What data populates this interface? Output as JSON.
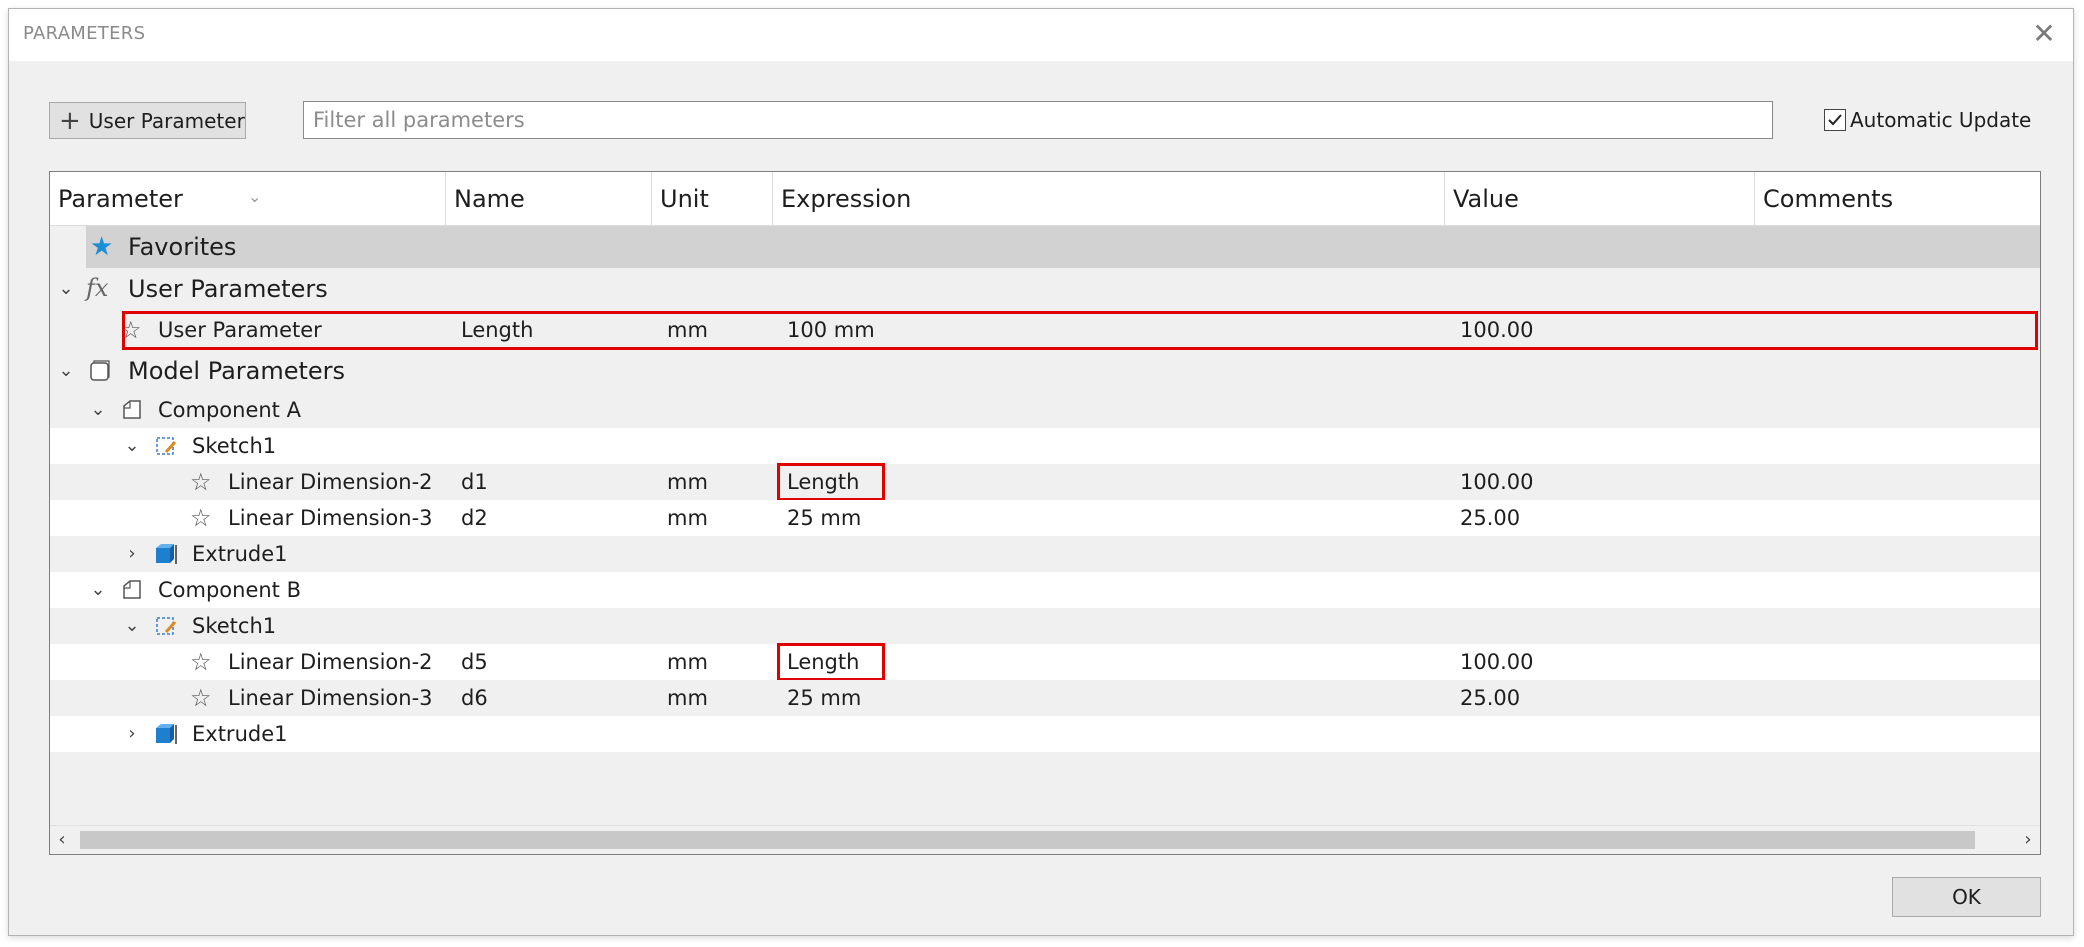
{
  "dialog": {
    "title": "PARAMETERS",
    "close_glyph": "✕",
    "add_button_label": "User Parameter",
    "add_button_glyph": "+",
    "filter_placeholder": "Filter all parameters",
    "auto_update_label": "Automatic Update",
    "auto_update_checked": true,
    "ok_label": "OK"
  },
  "columns": [
    "Parameter",
    "Name",
    "Unit",
    "Expression",
    "Value",
    "Comments"
  ],
  "groups": {
    "favorites": "Favorites",
    "user_parameters": "User Parameters",
    "model_parameters": "Model Parameters"
  },
  "user_parameter_row": {
    "parameter": "User Parameter",
    "name": "Length",
    "unit": "mm",
    "expression": "100 mm",
    "value": "100.00"
  },
  "component_a": {
    "label": "Component A",
    "sketch": "Sketch1",
    "rows": [
      {
        "parameter": "Linear Dimension-2",
        "name": "d1",
        "unit": "mm",
        "expression": "Length",
        "value": "100.00"
      },
      {
        "parameter": "Linear Dimension-3",
        "name": "d2",
        "unit": "mm",
        "expression": "25 mm",
        "value": "25.00"
      }
    ],
    "feature": "Extrude1"
  },
  "component_b": {
    "label": "Component B",
    "sketch": "Sketch1",
    "rows": [
      {
        "parameter": "Linear Dimension-2",
        "name": "d5",
        "unit": "mm",
        "expression": "Length",
        "value": "100.00"
      },
      {
        "parameter": "Linear Dimension-3",
        "name": "d6",
        "unit": "mm",
        "expression": "25 mm",
        "value": "25.00"
      }
    ],
    "feature": "Extrude1"
  },
  "colors": {
    "highlight": "#e00000",
    "favorite_star": "#1a8fd8",
    "body_icon": "#1f7fcf"
  }
}
